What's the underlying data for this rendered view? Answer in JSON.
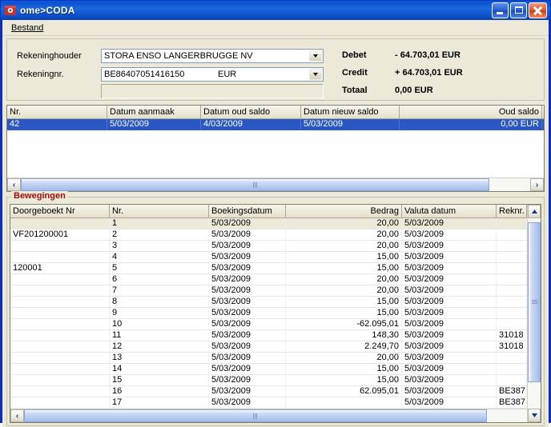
{
  "window": {
    "title": "ome>CODA",
    "icon": "app-icon",
    "buttons": {
      "minimize": "minimize-button",
      "maximize": "maximize-button",
      "close": "close-button"
    }
  },
  "menu": {
    "items": [
      {
        "label": "Bestand",
        "accel": "B"
      }
    ]
  },
  "form": {
    "fields": [
      {
        "label": "Rekeninghouder",
        "value": "STORA ENSO LANGERBRUGGE NV",
        "value2": ""
      },
      {
        "label": "Rekeningnr.",
        "value": "BE86407051416150",
        "value2": "EUR"
      }
    ],
    "extra_field_value": ""
  },
  "summary": {
    "rows": [
      {
        "label": "Debet",
        "value": "- 64.703,01 EUR"
      },
      {
        "label": "Credit",
        "value": "+ 64.703,01 EUR"
      },
      {
        "label": "Totaal",
        "value": "0,00 EUR"
      }
    ]
  },
  "top_grid": {
    "columns": [
      {
        "label": "Nr.",
        "width": 125,
        "align": "left"
      },
      {
        "label": "Datum aanmaak",
        "width": 117,
        "align": "left"
      },
      {
        "label": "Datum oud saldo",
        "width": 125,
        "align": "left"
      },
      {
        "label": "Datum nieuw saldo",
        "width": 123,
        "align": "left"
      },
      {
        "label": "Oud saldo",
        "width": 178,
        "align": "right"
      },
      {
        "label": "",
        "width": 10,
        "align": "left"
      }
    ],
    "rows": [
      {
        "selected": true,
        "cells": [
          "42",
          "5/03/2009",
          "4/03/2009",
          "5/03/2009",
          "0,00 EUR",
          ""
        ]
      }
    ],
    "hscroll": {
      "left_arrow": "‹",
      "right_arrow": "›",
      "thumb_pct": 92
    }
  },
  "group": {
    "title": "Bewegingen"
  },
  "bottom_grid": {
    "columns": [
      {
        "label": "Doorgeboekt  Nr",
        "width": 124,
        "align": "left"
      },
      {
        "label": "Nr.",
        "width": 124,
        "align": "left"
      },
      {
        "label": "Boekingsdatum",
        "width": 96,
        "align": "left"
      },
      {
        "label": "Bedrag",
        "width": 145,
        "align": "right"
      },
      {
        "label": "Valuta datum",
        "width": 118,
        "align": "left"
      },
      {
        "label": "Reknr.",
        "width": 38,
        "align": "left"
      }
    ],
    "rows": [
      {
        "alt": true,
        "cells": [
          "",
          "1",
          "5/03/2009",
          "20,00",
          "5/03/2009",
          ""
        ]
      },
      {
        "alt": false,
        "cells": [
          "VF201200001",
          "2",
          "5/03/2009",
          "20,00",
          "5/03/2009",
          ""
        ]
      },
      {
        "alt": false,
        "cells": [
          "",
          "3",
          "5/03/2009",
          "20,00",
          "5/03/2009",
          ""
        ]
      },
      {
        "alt": false,
        "cells": [
          "",
          "4",
          "5/03/2009",
          "15,00",
          "5/03/2009",
          ""
        ]
      },
      {
        "alt": false,
        "cells": [
          "120001",
          "5",
          "5/03/2009",
          "15,00",
          "5/03/2009",
          ""
        ]
      },
      {
        "alt": false,
        "cells": [
          "",
          "6",
          "5/03/2009",
          "20,00",
          "5/03/2009",
          ""
        ]
      },
      {
        "alt": false,
        "cells": [
          "",
          "7",
          "5/03/2009",
          "20,00",
          "5/03/2009",
          ""
        ]
      },
      {
        "alt": false,
        "cells": [
          "",
          "8",
          "5/03/2009",
          "15,00",
          "5/03/2009",
          ""
        ]
      },
      {
        "alt": false,
        "cells": [
          "",
          "9",
          "5/03/2009",
          "15,00",
          "5/03/2009",
          ""
        ]
      },
      {
        "alt": false,
        "cells": [
          "",
          "10",
          "5/03/2009",
          "-62.095,01",
          "5/03/2009",
          ""
        ]
      },
      {
        "alt": false,
        "cells": [
          "",
          "11",
          "5/03/2009",
          "148,30",
          "5/03/2009",
          "31018"
        ]
      },
      {
        "alt": false,
        "cells": [
          "",
          "12",
          "5/03/2009",
          "2.249,70",
          "5/03/2009",
          "31018"
        ]
      },
      {
        "alt": false,
        "cells": [
          "",
          "13",
          "5/03/2009",
          "20,00",
          "5/03/2009",
          ""
        ]
      },
      {
        "alt": false,
        "cells": [
          "",
          "14",
          "5/03/2009",
          "15,00",
          "5/03/2009",
          ""
        ]
      },
      {
        "alt": false,
        "cells": [
          "",
          "15",
          "5/03/2009",
          "15,00",
          "5/03/2009",
          ""
        ]
      },
      {
        "alt": false,
        "cells": [
          "",
          "16",
          "5/03/2009",
          "62.095,01",
          "5/03/2009",
          "BE387"
        ]
      },
      {
        "alt": false,
        "cells": [
          "",
          "17",
          "5/03/2009",
          "",
          "5/03/2009",
          "BE387"
        ]
      }
    ],
    "vscroll": {
      "up_arrow": "⌃",
      "down_arrow": "⌄",
      "thumb_top_pct": 2,
      "thumb_height_pct": 84
    },
    "hscroll": {
      "left_arrow": "‹",
      "right_arrow": "›",
      "thumb_pct": 92
    }
  },
  "colors": {
    "title_bar": "#0a52d0",
    "client": "#ece9d8",
    "selection": "#2a57c4",
    "group_title": "#9e0b0b",
    "alt_row": "#ece9d8"
  }
}
